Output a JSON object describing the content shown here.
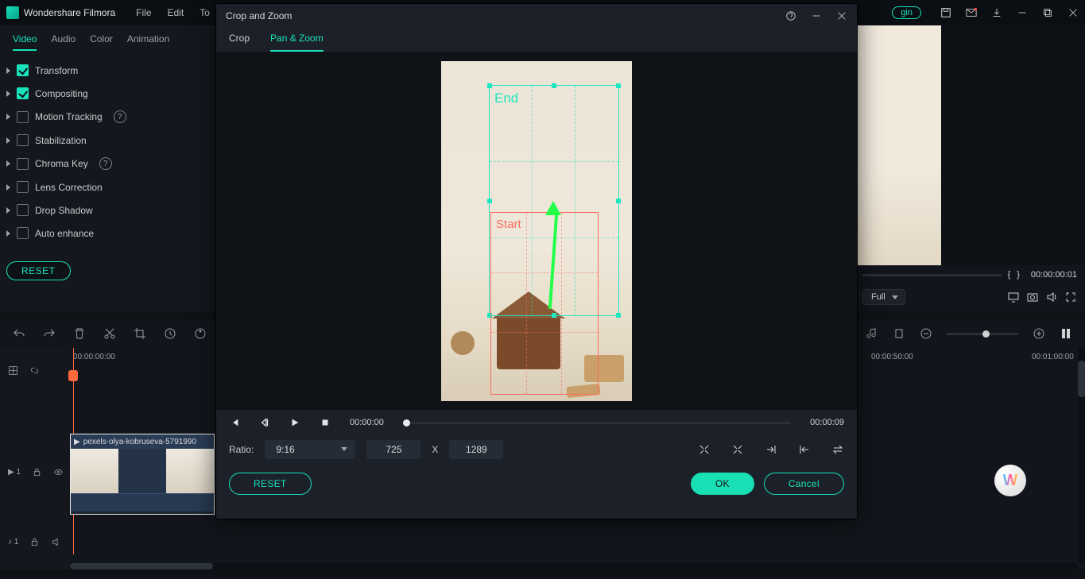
{
  "app": {
    "title": "Wondershare Filmora"
  },
  "menu": {
    "file": "File",
    "edit": "Edit",
    "to": "To"
  },
  "login": "gin",
  "prop": {
    "tabs": {
      "video": "Video",
      "audio": "Audio",
      "color": "Color",
      "animation": "Animation"
    },
    "items": {
      "transform": "Transform",
      "compositing": "Compositing",
      "motion_tracking": "Motion Tracking",
      "stabilization": "Stabilization",
      "chroma_key": "Chroma Key",
      "lens_correction": "Lens Correction",
      "drop_shadow": "Drop Shadow",
      "auto_enhance": "Auto enhance"
    },
    "reset": "RESET"
  },
  "modal": {
    "title": "Crop and Zoom",
    "tabs": {
      "crop": "Crop",
      "panzoom": "Pan & Zoom"
    },
    "labels": {
      "end": "End",
      "start": "Start"
    },
    "time_current": "00:00:00",
    "time_total": "00:00:09",
    "ratio_label": "Ratio:",
    "ratio_value": "9:16",
    "width": "725",
    "x": "X",
    "height": "1289",
    "reset": "RESET",
    "ok": "OK",
    "cancel": "Cancel"
  },
  "preview": {
    "marker_open": "{",
    "marker_close": "}",
    "timecode": "00:00:00:01",
    "playback": "Full"
  },
  "timeline": {
    "ruler_start": "00:00:00:00",
    "ruler_50": "00:00:50:00",
    "ruler_60": "00:01:00:00",
    "video_track": "1",
    "audio_track": "1",
    "clip_name": "pexels-olya-kobruseva-5791990"
  },
  "tracklabel": {
    "video": "▸",
    "audio": "♪"
  }
}
